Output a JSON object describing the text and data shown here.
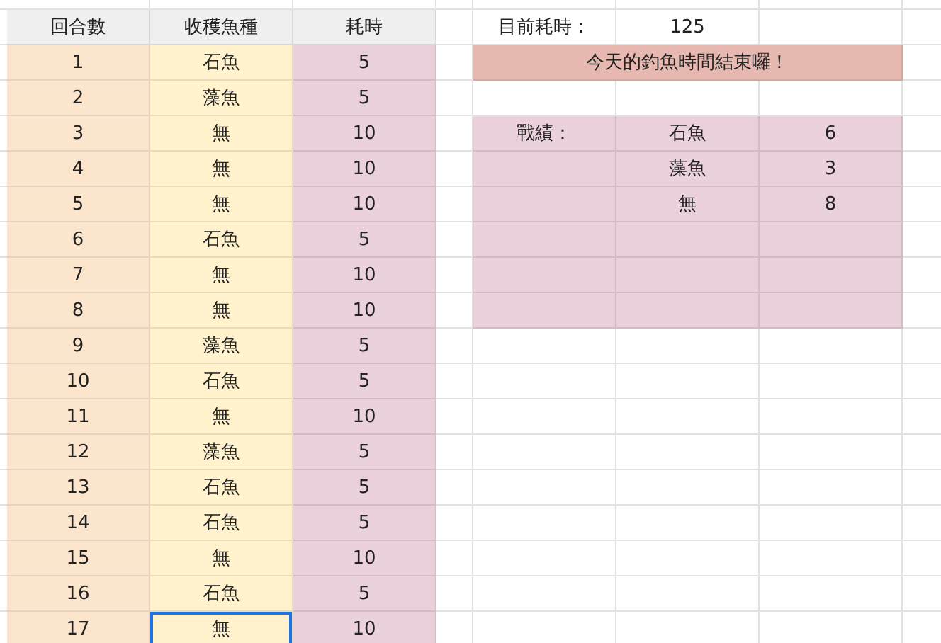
{
  "table": {
    "columns": [
      "回合數",
      "收穫魚種",
      "耗時"
    ],
    "rows": [
      {
        "round": "1",
        "catch": "石魚",
        "time": "5",
        "selected": false
      },
      {
        "round": "2",
        "catch": "藻魚",
        "time": "5",
        "selected": false
      },
      {
        "round": "3",
        "catch": "無",
        "time": "10",
        "selected": false
      },
      {
        "round": "4",
        "catch": "無",
        "time": "10",
        "selected": false
      },
      {
        "round": "5",
        "catch": "無",
        "time": "10",
        "selected": false
      },
      {
        "round": "6",
        "catch": "石魚",
        "time": "5",
        "selected": false
      },
      {
        "round": "7",
        "catch": "無",
        "time": "10",
        "selected": false
      },
      {
        "round": "8",
        "catch": "無",
        "time": "10",
        "selected": false
      },
      {
        "round": "9",
        "catch": "藻魚",
        "time": "5",
        "selected": false
      },
      {
        "round": "10",
        "catch": "石魚",
        "time": "5",
        "selected": false
      },
      {
        "round": "11",
        "catch": "無",
        "time": "10",
        "selected": false
      },
      {
        "round": "12",
        "catch": "藻魚",
        "time": "5",
        "selected": false
      },
      {
        "round": "13",
        "catch": "石魚",
        "time": "5",
        "selected": false
      },
      {
        "round": "14",
        "catch": "石魚",
        "time": "5",
        "selected": false
      },
      {
        "round": "15",
        "catch": "無",
        "time": "10",
        "selected": false
      },
      {
        "round": "16",
        "catch": "石魚",
        "time": "5",
        "selected": false
      },
      {
        "round": "17",
        "catch": "無",
        "time": "10",
        "selected": true
      }
    ]
  },
  "elapsed": {
    "label": "目前耗時：",
    "value": "125"
  },
  "banner": "今天的釣魚時間結束囉！",
  "results": {
    "label": "戰績：",
    "items": [
      {
        "fish": "石魚",
        "count": "6"
      },
      {
        "fish": "藻魚",
        "count": "3"
      },
      {
        "fish": "無",
        "count": "8"
      }
    ]
  }
}
